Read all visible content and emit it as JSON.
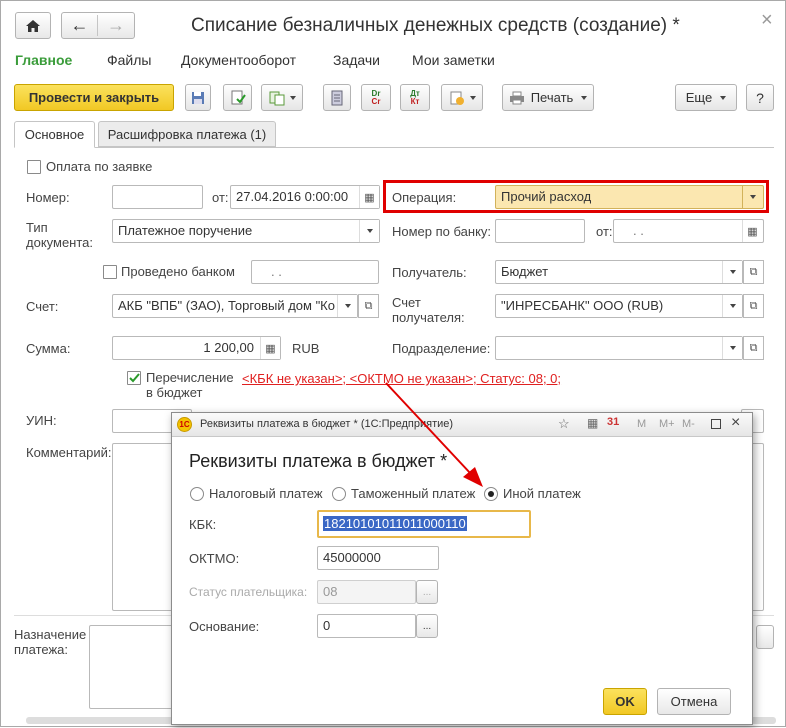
{
  "window": {
    "title": "Списание безналичных денежных средств (создание) *",
    "nav_home": "⌂",
    "nav_back": "←",
    "nav_fwd": "→",
    "close": "×"
  },
  "menu": [
    "Главное",
    "Файлы",
    "Документооборот",
    "Задачи",
    "Мои заметки"
  ],
  "toolbar": {
    "post_close": "Провести и закрыть",
    "dt_cr": "Dr\nCr",
    "print": "Печать",
    "more": "Еще",
    "help": "?"
  },
  "tabs": [
    "Основное",
    "Расшифровка платежа (1)"
  ],
  "form": {
    "pay_on_request": "Оплата по заявке",
    "number_label": "Номер:",
    "number_value": "",
    "from_label": "от:",
    "date_value": "27.04.2016  0:00:00",
    "operation_label": "Операция:",
    "operation_value": "Прочий расход",
    "doctype_label": "Тип документа:",
    "doctype_value": "Платежное поручение",
    "bank_number_label": "Номер по банку:",
    "bank_from_label": "от:",
    "bank_date_value": ".   .",
    "bank_done_label": "Проведено банком",
    "bank_done_date": ".   .",
    "recipient_label": "Получатель:",
    "recipient_value": "Бюджет",
    "account_label": "Счет:",
    "account_value": "АКБ \"ВПБ\" (ЗАО), Торговый дом \"Ко",
    "rec_account_label": "Счет получателя:",
    "rec_account_value": "\"ИНРЕСБАНК\" ООО (RUB)",
    "sum_label": "Сумма:",
    "sum_value": "1 200,00",
    "currency": "RUB",
    "division_label": "Подразделение:",
    "division_value": "",
    "budget_transfer_label": "Перечисление в бюджет",
    "budget_link": "<КБК не указан>; <ОКТМО не указан>; Статус: 08; 0;",
    "uin_label": "УИН:",
    "comment_label": "Комментарий:",
    "purpose_label": "Назначение платежа:"
  },
  "dialog": {
    "title": "Реквизиты платежа в бюджет * (1С:Предприятие)",
    "heading": "Реквизиты платежа в бюджет *",
    "radio_tax": "Налоговый платеж",
    "radio_customs": "Таможенный платеж",
    "radio_other": "Иной платеж",
    "kbk_label": "КБК:",
    "kbk_value": "18210101011011000110",
    "oktmo_label": "ОКТМО:",
    "oktmo_value": "45000000",
    "status_label": "Статус плательщика:",
    "status_value": "08",
    "basis_label": "Основание:",
    "basis_value": "0",
    "ok": "OK",
    "cancel": "Отмена",
    "ellipsis": "..."
  },
  "colors": {
    "green_menu": "#3a9c3a",
    "primary_btn": "#f5d33a",
    "operation_highlight": "#fbe7b0",
    "red_frame": "#e00000",
    "link_red": "#e02020",
    "kbk_selected": "#3a67c5"
  }
}
